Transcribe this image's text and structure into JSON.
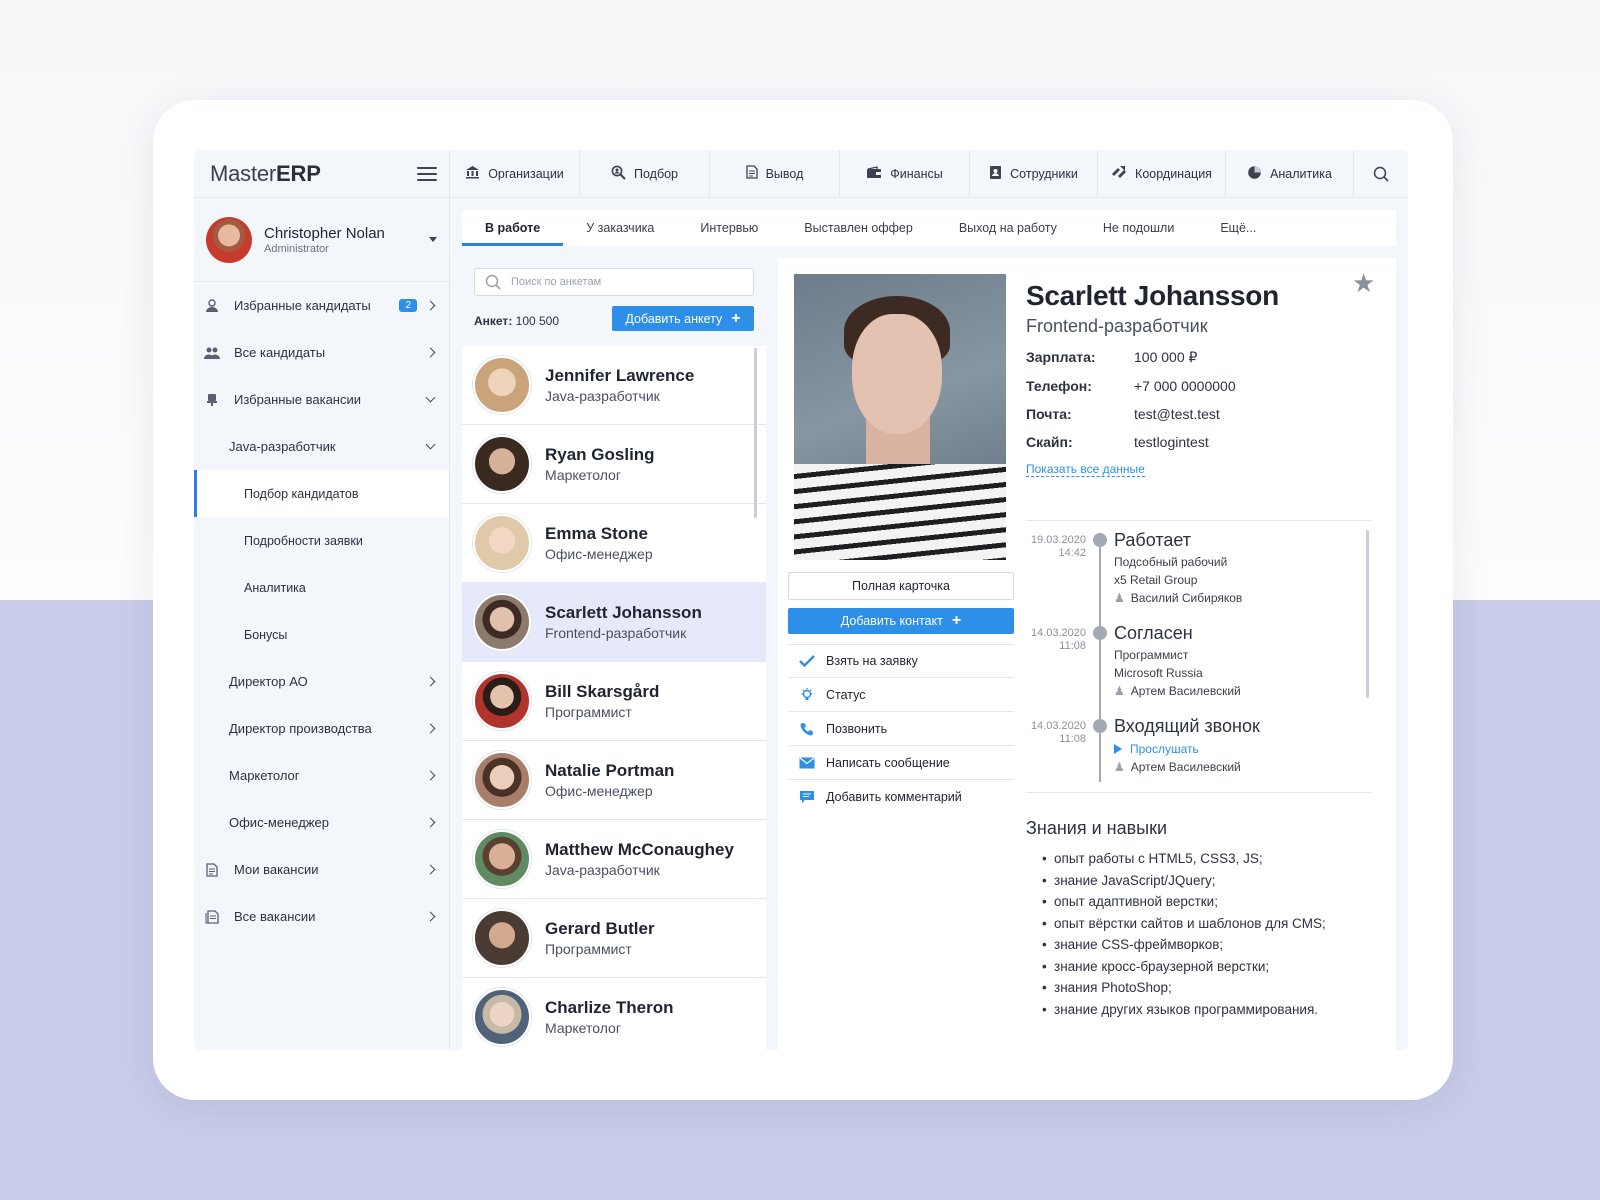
{
  "app": {
    "logo_light": "Master",
    "logo_bold": "ERP"
  },
  "user": {
    "name": "Christopher Nolan",
    "role": "Administrator"
  },
  "sidebar": {
    "items": [
      {
        "label": "Избранные кандидаты",
        "badge": "2"
      },
      {
        "label": "Все кандидаты"
      },
      {
        "label": "Избранные вакансии"
      },
      {
        "label": "Java-разработчик"
      },
      {
        "label": "Подбор кандидатов"
      },
      {
        "label": "Подробности заявки"
      },
      {
        "label": "Аналитика"
      },
      {
        "label": "Бонусы"
      },
      {
        "label": "Директор АО"
      },
      {
        "label": "Директор производства"
      },
      {
        "label": "Маркетолог"
      },
      {
        "label": "Офис-менеджер"
      },
      {
        "label": "Мои вакансии"
      },
      {
        "label": "Все вакансии"
      }
    ]
  },
  "topnav": {
    "items": [
      {
        "label": "Организации",
        "icon": "bank-icon"
      },
      {
        "label": "Подбор",
        "icon": "search-person-icon"
      },
      {
        "label": "Вывод",
        "icon": "document-icon"
      },
      {
        "label": "Финансы",
        "icon": "wallet-icon"
      },
      {
        "label": "Сотрудники",
        "icon": "contacts-icon"
      },
      {
        "label": "Координация",
        "icon": "arrows-icon"
      },
      {
        "label": "Аналитика",
        "icon": "pie-chart-icon"
      }
    ]
  },
  "tabs": [
    "В работе",
    "У заказчика",
    "Интервью",
    "Выставлен оффер",
    "Выход на работу",
    "Не подошли",
    "Ещё..."
  ],
  "list": {
    "search_placeholder": "Поиск по анкетам",
    "count_label": "Анкет:",
    "count_value": "100 500",
    "add_label": "Добавить анкету",
    "candidates": [
      {
        "name": "Jennifer Lawrence",
        "role": "Java-разработчик",
        "color": "#c9a37a"
      },
      {
        "name": "Ryan Gosling",
        "role": "Маркетолог",
        "color": "#6b4a36"
      },
      {
        "name": "Emma Stone",
        "role": "Офис-менеджер",
        "color": "#e0c9a8"
      },
      {
        "name": "Scarlett Johansson",
        "role": "Frontend-разработчик",
        "color": "#8c7a6e"
      },
      {
        "name": "Bill Skarsgård",
        "role": "Программист",
        "color": "#b1342c"
      },
      {
        "name": "Natalie Portman",
        "role": "Офис-менеджер",
        "color": "#a87d6a"
      },
      {
        "name": "Matthew McConaughey",
        "role": "Java-разработчик",
        "color": "#5f8a62"
      },
      {
        "name": "Gerard Butler",
        "role": "Программист",
        "color": "#4a3b33"
      },
      {
        "name": "Charlize Theron",
        "role": "Маркетолог",
        "color": "#c7b9a5"
      }
    ]
  },
  "detail": {
    "name": "Scarlett Johansson",
    "position": "Frontend-разработчик",
    "fields": [
      {
        "key": "Зарплата:",
        "value": "100 000 ₽"
      },
      {
        "key": "Телефон:",
        "value": "+7 000 0000000"
      },
      {
        "key": "Почта:",
        "value": "test@test.test"
      },
      {
        "key": "Скайп:",
        "value": "testlogintest"
      }
    ],
    "show_all": "Показать все данные",
    "full_card": "Полная карточка",
    "add_contact": "Добавить контакт",
    "actions": [
      {
        "label": "Взять на заявку",
        "icon": "check-icon"
      },
      {
        "label": "Статус",
        "icon": "bulb-icon"
      },
      {
        "label": "Позвонить",
        "icon": "phone-icon"
      },
      {
        "label": "Написать сообщение",
        "icon": "envelope-icon"
      },
      {
        "label": "Добавить комментарий",
        "icon": "comment-icon"
      }
    ],
    "timeline": [
      {
        "date": "19.03.2020",
        "time": "14:42",
        "title": "Работает",
        "sub1": "Подсобный рабочий",
        "sub2": "x5 Retail Group",
        "user": "Василий Сибиряков"
      },
      {
        "date": "14.03.2020",
        "time": "11:08",
        "title": "Согласен",
        "sub1": "Программист",
        "sub2": "Microsoft Russia",
        "user": "Артем Василевский"
      },
      {
        "date": "14.03.2020",
        "time": "11:08",
        "title": "Входящий звонок",
        "play": "Прослушать",
        "user": "Артем Василевский"
      }
    ],
    "skills_title": "Знания и навыки",
    "skills": [
      "опыт работы с HTML5, CSS3, JS;",
      "знание JavaScript/JQuery;",
      "опыт адаптивной верстки;",
      "опыт вёрстки сайтов и шаблонов для CMS;",
      "знание CSS-фреймворков;",
      "знание кросс-браузерной верстки;",
      "знания PhotoShop;",
      "знание других языков программирования."
    ]
  },
  "colors": {
    "accent": "#2d8fe8",
    "selected_row": "#e5e9fb",
    "app_bg": "#f3f6fb"
  }
}
